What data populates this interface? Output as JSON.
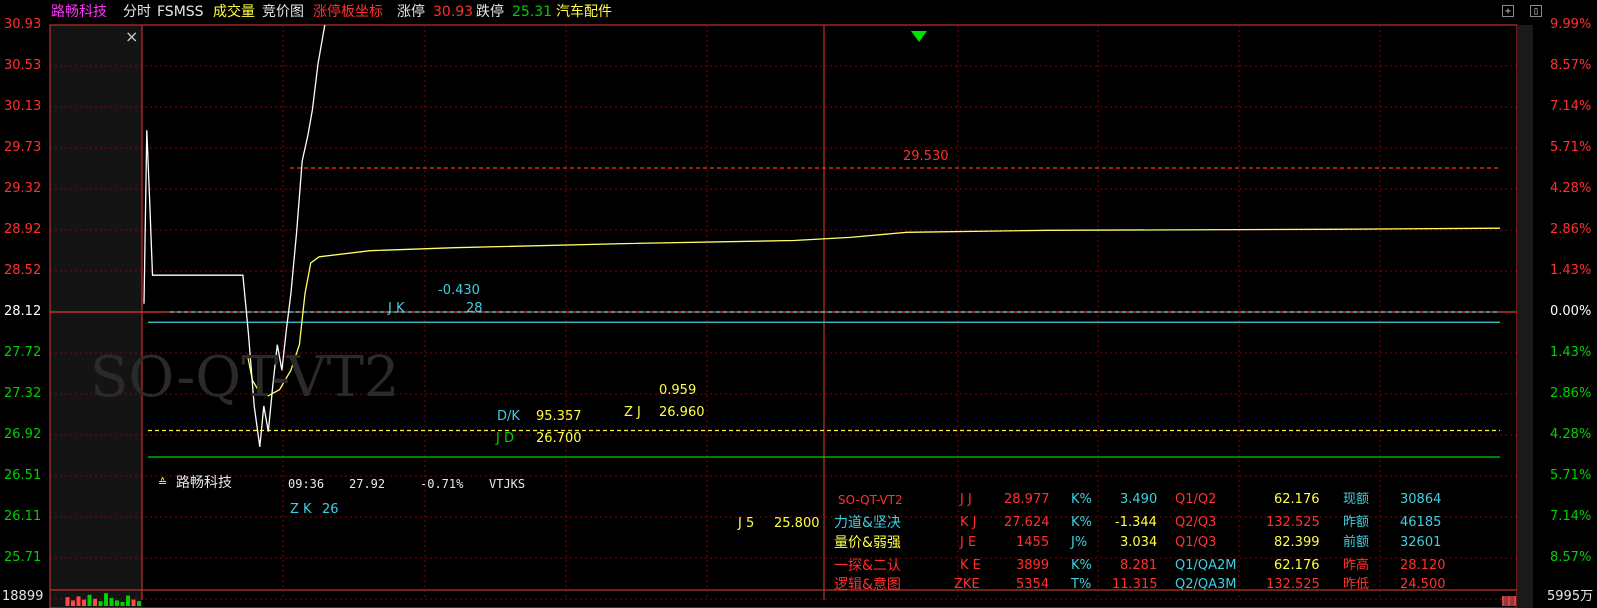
{
  "header": {
    "stock_name": "路畅科技",
    "mode": "分时",
    "indicator": "FSMSS",
    "volume_label": "成交量",
    "auction_label": "竞价图",
    "limit_coord_label": "涨停板坐标",
    "limit_up_label": "涨停",
    "limit_up_value": "30.93",
    "limit_down_label": "跌停",
    "limit_down_value": "25.31",
    "sector": "汽车配件"
  },
  "colors": {
    "background": "#000000",
    "grid": "#8b0000",
    "axis_red": "#ff3030",
    "up_red": "#ff4a4a",
    "down_green": "#00d000",
    "price_line": "#ffffff",
    "avg_line": "#ffff66",
    "cyan": "#3fd0e0",
    "yellow": "#ffff44",
    "magenta": "#ff33ff"
  },
  "icons": {
    "close": "close-icon",
    "expand": "expand-icon",
    "restore": "restore-icon",
    "marker": "triangle-down-icon",
    "stock_tag": "double-chevron-up-icon"
  },
  "close_symbol": "×",
  "expand_symbol": "+",
  "restore_symbol": "▯",
  "stock_tag_symbol": "≙",
  "watermark": "SO-QT-VT2",
  "chart_data": {
    "type": "line",
    "prev_close": 28.12,
    "ylim": [
      25.31,
      30.93
    ],
    "left_ticks": [
      "30.93",
      "30.53",
      "30.13",
      "29.73",
      "29.32",
      "28.92",
      "28.52",
      "28.12",
      "27.72",
      "27.32",
      "26.92",
      "26.51",
      "26.11",
      "25.71"
    ],
    "right_ticks": [
      "9.99%",
      "8.57%",
      "7.14%",
      "5.71%",
      "4.28%",
      "2.86%",
      "1.43%",
      "0.00%",
      "1.43%",
      "2.86%",
      "4.28%",
      "5.71%",
      "7.14%",
      "8.57%"
    ],
    "volume_left_label": "18899",
    "volume_right_label": "5995万",
    "price_series": {
      "name": "price",
      "points": [
        [
          0,
          28.2
        ],
        [
          0.5,
          29.9
        ],
        [
          1,
          29.2
        ],
        [
          1.5,
          28.48
        ],
        [
          10,
          28.48
        ],
        [
          17.5,
          28.48
        ],
        [
          18.5,
          27.9
        ],
        [
          19.5,
          27.2
        ],
        [
          20.5,
          26.8
        ],
        [
          21.2,
          27.2
        ],
        [
          22,
          26.95
        ],
        [
          22.8,
          27.4
        ],
        [
          23.6,
          27.8
        ],
        [
          24.4,
          27.55
        ],
        [
          25.2,
          27.95
        ],
        [
          26,
          28.3
        ],
        [
          27,
          28.9
        ],
        [
          28,
          29.6
        ],
        [
          29,
          29.85
        ],
        [
          29.8,
          30.1
        ],
        [
          30.8,
          30.55
        ],
        [
          32,
          30.93
        ]
      ]
    },
    "avg_series": {
      "name": "avg",
      "points": [
        [
          18.3,
          27.7
        ],
        [
          19.2,
          27.45
        ],
        [
          20.5,
          27.33
        ],
        [
          22,
          27.3
        ],
        [
          24,
          27.36
        ],
        [
          26,
          27.55
        ],
        [
          27.5,
          27.8
        ],
        [
          28.5,
          28.3
        ],
        [
          29.5,
          28.6
        ],
        [
          31,
          28.66
        ],
        [
          40,
          28.72
        ],
        [
          55,
          28.75
        ],
        [
          85,
          28.79
        ],
        [
          115,
          28.82
        ],
        [
          125,
          28.85
        ],
        [
          135,
          28.9
        ],
        [
          160,
          28.92
        ],
        [
          210,
          28.93
        ],
        [
          240,
          28.94
        ]
      ]
    },
    "ref_lines": [
      {
        "id": "line-29530",
        "price": 29.53,
        "style": "dashed",
        "color": "#ff3030",
        "label": "29.530"
      },
      {
        "id": "line-prevclose",
        "price": 28.12,
        "style": "dashed",
        "color": "#3fd0e0"
      },
      {
        "id": "line-cyan",
        "price": 28.02,
        "style": "solid",
        "color": "#3fd0e0"
      },
      {
        "id": "line-zj",
        "price": 26.96,
        "style": "dashed",
        "color": "#ffff44"
      },
      {
        "id": "line-jd",
        "price": 26.7,
        "style": "solid",
        "color": "#00d000"
      }
    ],
    "volume_bars": [
      {
        "t": 1,
        "value": 0.55,
        "color": "red"
      },
      {
        "t": 2,
        "value": 0.35,
        "color": "red"
      },
      {
        "t": 3,
        "value": 0.6,
        "color": "red"
      },
      {
        "t": 4,
        "value": 0.4,
        "color": "red"
      },
      {
        "t": 5,
        "value": 0.7,
        "color": "green"
      },
      {
        "t": 6,
        "value": 0.45,
        "color": "red"
      },
      {
        "t": 7,
        "value": 0.3,
        "color": "green"
      },
      {
        "t": 8,
        "value": 0.8,
        "color": "green"
      },
      {
        "t": 9,
        "value": 0.5,
        "color": "green"
      },
      {
        "t": 10,
        "value": 0.35,
        "color": "green"
      },
      {
        "t": 11,
        "value": 0.25,
        "color": "green"
      },
      {
        "t": 12,
        "value": 0.65,
        "color": "green"
      },
      {
        "t": 13,
        "value": 0.4,
        "color": "red"
      },
      {
        "t": 14,
        "value": 0.3,
        "color": "green"
      }
    ]
  },
  "labels": {
    "jk_label": "J K",
    "jk_delta": "-0.430",
    "jk_value": "28",
    "dk_label": "D/K",
    "dk_value": "95.357",
    "zj_label": "Z J",
    "zj_top": "0.959",
    "zj_value": "26.960",
    "jd_label": "J D",
    "jd_value": "26.700",
    "zk_label": "Z K",
    "zk_value": "26",
    "j5_label": "J 5",
    "j5_value": "25.800"
  },
  "stock_info": {
    "name": "路畅科技",
    "time": "09:36",
    "price": "27.92",
    "change": "-0.71%",
    "code": "VTJKS"
  },
  "table": {
    "c1": [
      "SO-QT-VT2",
      "力道&坚决",
      "量价&弱强",
      "一探&二认",
      "逻辑&意图"
    ],
    "c2": [
      "J J",
      "K J",
      "J E",
      "K E",
      "ZKE"
    ],
    "c3": [
      "28.977",
      "27.624",
      "1455",
      "3899",
      "5354"
    ],
    "c4": [
      "K%",
      "K%",
      "J%",
      "K%",
      "T%"
    ],
    "c5": [
      "3.490",
      "-1.344",
      "3.034",
      "8.281",
      "11.315"
    ],
    "c6": [
      "Q1/Q2",
      "Q2/Q3",
      "Q1/Q3",
      "Q1/QA2M",
      "Q2/QA3M"
    ],
    "c7": [
      "62.176",
      "132.525",
      "82.399",
      "62.176",
      "132.525"
    ],
    "c8": [
      "现额",
      "昨额",
      "前额",
      "昨高",
      "昨低"
    ],
    "c9": [
      "30864",
      "46185",
      "32601",
      "28.120",
      "24.500"
    ]
  }
}
